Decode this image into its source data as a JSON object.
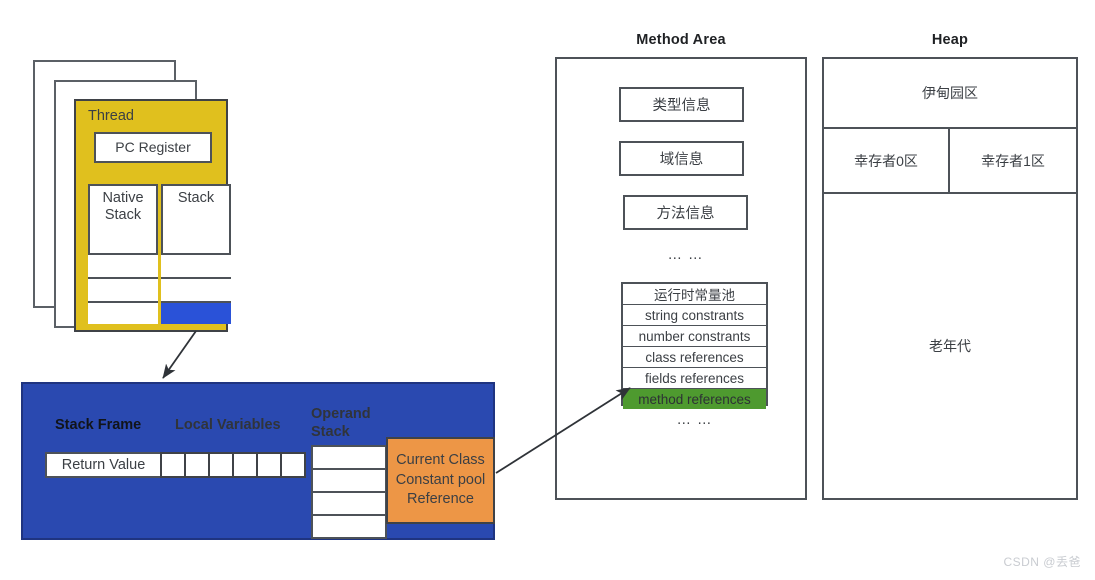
{
  "sections": {
    "method_area_title": "Method Area",
    "heap_title": "Heap"
  },
  "thread": {
    "title": "Thread",
    "pc_register": "PC Register",
    "native_stack_label": "Native Stack",
    "stack_label": "Stack",
    "ghost_count": 2,
    "native_cells": 3,
    "stack_cells": 3,
    "highlighted_cell_index": 2
  },
  "stack_frame": {
    "title": "Stack Frame",
    "return_value": "Return Value",
    "local_variables_title": "Local Variables",
    "local_variable_slots": 6,
    "operand_stack_title": "Operand Stack",
    "operand_stack_slots": 4,
    "constant_pool_reference": "Current Class Constant pool Reference"
  },
  "method_area": {
    "items": [
      {
        "label": "类型信息"
      },
      {
        "label": "域信息"
      },
      {
        "label": "方法信息"
      }
    ],
    "ellipsis_top": "… …",
    "pool": {
      "rows": [
        {
          "label": "运行时常量池",
          "highlighted": false
        },
        {
          "label": "string constrants",
          "highlighted": false
        },
        {
          "label": "number constrants",
          "highlighted": false
        },
        {
          "label": "class references",
          "highlighted": false
        },
        {
          "label": "fields references",
          "highlighted": false
        },
        {
          "label": "method references",
          "highlighted": true
        }
      ]
    },
    "ellipsis_bottom": "… …"
  },
  "heap": {
    "eden": "伊甸园区",
    "survivor0": "幸存者0区",
    "survivor1": "幸存者1区",
    "old_gen": "老年代"
  },
  "watermark": "CSDN @丢爸",
  "colors": {
    "thread_yellow": "#e0c01e",
    "frame_blue": "#2a49b0",
    "cell_blue": "#2a52d8",
    "orange": "#ed9646",
    "green": "#4e9a2f",
    "outline": "#4d5258",
    "text": "#3b3f44"
  }
}
